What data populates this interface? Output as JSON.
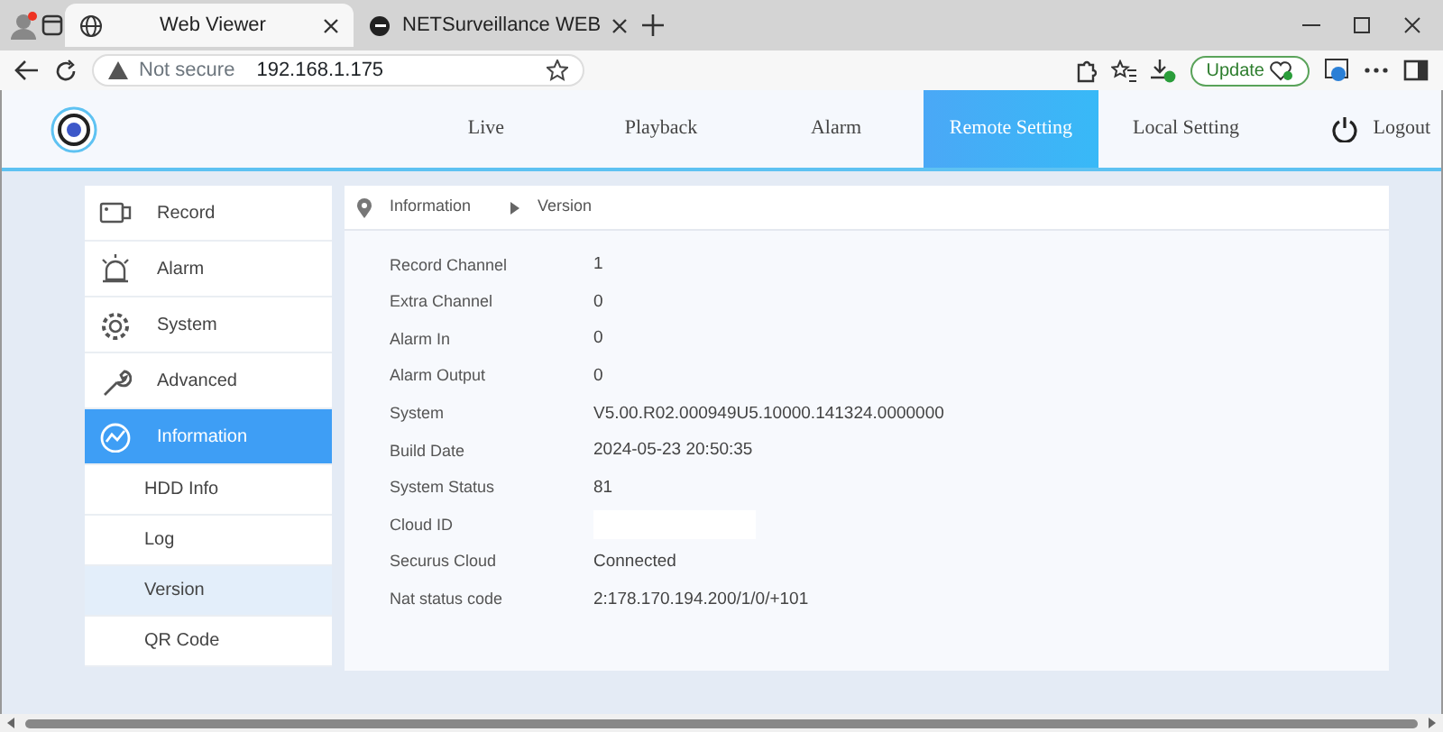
{
  "browser": {
    "tabs": [
      {
        "title": "Web Viewer",
        "selected": true
      },
      {
        "title": "NETSurveillance WEB",
        "selected": false
      }
    ],
    "address": {
      "security": "Not secure",
      "url": "192.168.1.175"
    },
    "update_button": "Update"
  },
  "nav": [
    {
      "label": "Live",
      "selected": false
    },
    {
      "label": "Playback",
      "selected": false
    },
    {
      "label": "Alarm",
      "selected": false
    },
    {
      "label": "Remote Setting",
      "selected": true
    },
    {
      "label": "Local Setting",
      "selected": false
    }
  ],
  "logout": "Logout",
  "sidebar": {
    "items": [
      {
        "label": "Record",
        "kind": "main",
        "selected": false
      },
      {
        "label": "Alarm",
        "kind": "main",
        "selected": false
      },
      {
        "label": "System",
        "kind": "main",
        "selected": false
      },
      {
        "label": "Advanced",
        "kind": "main",
        "selected": false
      },
      {
        "label": "Information",
        "kind": "main",
        "selected": true
      },
      {
        "label": "HDD Info",
        "kind": "sub",
        "selected": false
      },
      {
        "label": "Log",
        "kind": "sub",
        "selected": false
      },
      {
        "label": "Version",
        "kind": "sub",
        "selected": true
      },
      {
        "label": "QR Code",
        "kind": "sub",
        "selected": false
      }
    ]
  },
  "breadcrumb": [
    "Information",
    "Version"
  ],
  "info": [
    {
      "label": "Record Channel",
      "value": "1"
    },
    {
      "label": "Extra Channel",
      "value": "0"
    },
    {
      "label": "Alarm In",
      "value": "0"
    },
    {
      "label": "Alarm Output",
      "value": "0"
    },
    {
      "label": "System",
      "value": "V5.00.R02.000949U5.10000.141324.0000000"
    },
    {
      "label": "Build Date",
      "value": "2024-05-23 20:50:35"
    },
    {
      "label": "System Status",
      "value": "81"
    },
    {
      "label": "Cloud ID",
      "redacted": true
    },
    {
      "label": "Securus Cloud",
      "value": "Connected"
    },
    {
      "label": "Nat status code",
      "value": "2:178.170.194.200/1/0/+101"
    }
  ]
}
